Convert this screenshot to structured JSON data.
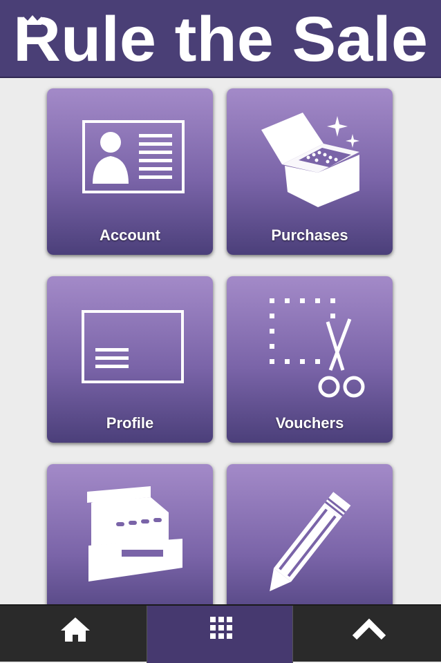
{
  "header": {
    "title": "Rule the Sale",
    "logo_icon": "crown-icon",
    "background": "#4a3f76"
  },
  "tiles": [
    {
      "label": "Account",
      "icon": "id-card-icon"
    },
    {
      "label": "Purchases",
      "icon": "treasure-box-icon"
    },
    {
      "label": "Profile",
      "icon": "profile-card-icon"
    },
    {
      "label": "Vouchers",
      "icon": "scissors-coupon-icon"
    },
    {
      "label": "",
      "icon": "cash-register-icon"
    },
    {
      "label": "",
      "icon": "pencil-icon"
    }
  ],
  "tabbar": {
    "tabs": [
      {
        "icon": "home-icon",
        "active": false
      },
      {
        "icon": "grid-icon",
        "active": true
      },
      {
        "icon": "chevron-up-icon",
        "active": false
      }
    ]
  },
  "colors": {
    "tile_top": "#a38ac8",
    "tile_bottom": "#4b3f7a",
    "tabbar": "#2a2a2a",
    "tab_active": "#46396f"
  }
}
